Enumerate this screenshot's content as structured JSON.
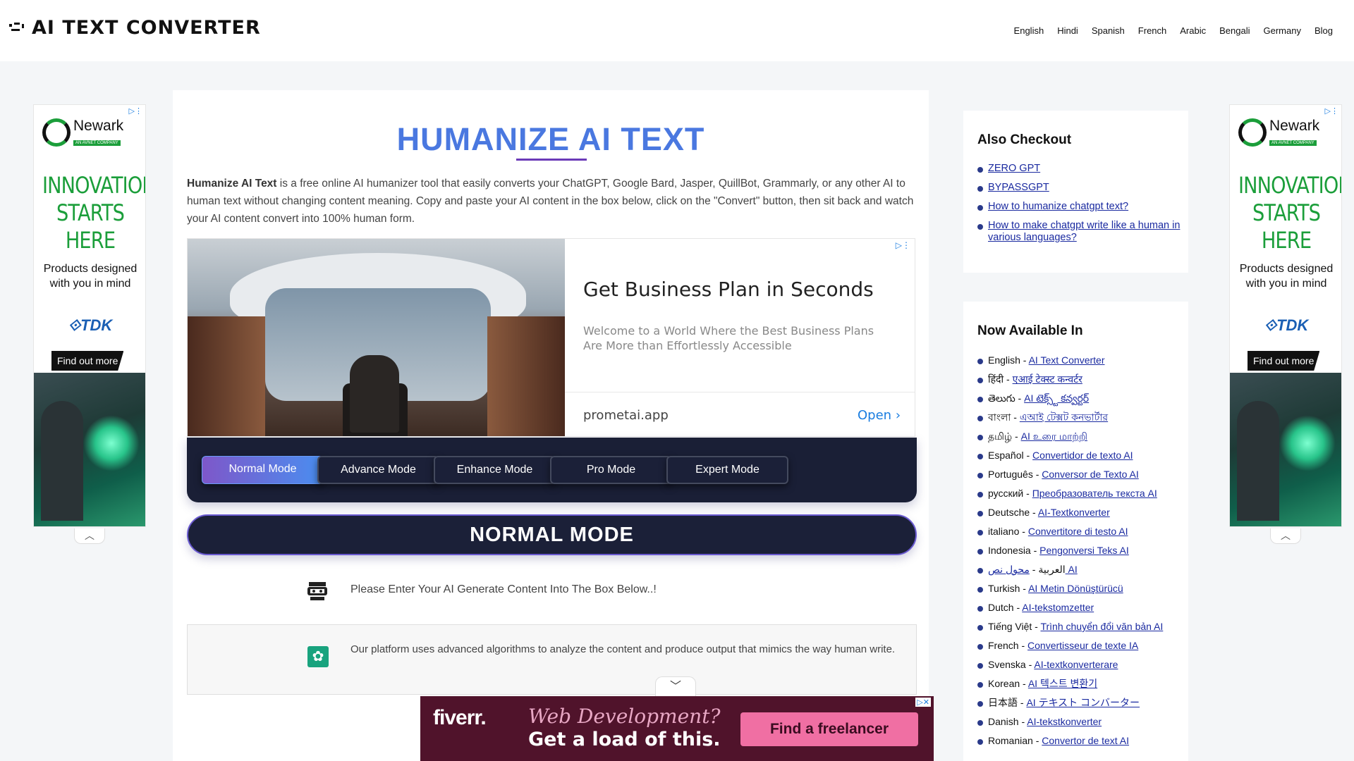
{
  "header": {
    "logo_text": "AI TEXT CONVERTER",
    "nav": [
      "English",
      "Hindi",
      "Spanish",
      "French",
      "Arabic",
      "Bengali",
      "Germany",
      "Blog"
    ]
  },
  "side_ad": {
    "brand": "Newark",
    "brand_sub": "AN AVNET COMPANY",
    "headline": "INNOVATION STARTS HERE",
    "tagline": "Products designed with you in mind",
    "partner": "TDK",
    "cta": "Find out more",
    "choices_icon": "ad-choices-icon",
    "collapse_icon": "chevron-up-icon"
  },
  "main": {
    "title": "HUMANIZE AI TEXT",
    "intro_bold": "Humanize AI Text",
    "intro_rest": " is a free online AI humanizer tool that easily converts your ChatGPT, Google Bard, Jasper, QuillBot, Grammarly, or any other AI to human text without changing content meaning. Copy and paste your AI content in the box below, click on the \"Convert\" button, then sit back and watch your AI content convert into 100% human form.",
    "biz_ad": {
      "title": "Get Business Plan in Seconds",
      "description": "Welcome to a World Where the Best Business Plans Are More than Effortlessly Accessible",
      "domain": "prometai.app",
      "open_label": "Open"
    },
    "modes": [
      "Normal Mode",
      "Advance Mode",
      "Enhance Mode",
      "Pro Mode",
      "Expert Mode"
    ],
    "active_mode": "Normal Mode",
    "mode_heading": "NORMAL MODE",
    "prompt": "Please Enter Your AI Generate Content Into The Box Below..!",
    "info": "Our platform uses advanced algorithms to analyze the content and produce output that mimics the way human write."
  },
  "sidebar": {
    "checkout_title": "Also Checkout",
    "checkout_links": [
      "ZERO GPT",
      "BYPASSGPT",
      "How to humanize chatgpt text?",
      "How to make chatgpt write like a human in various languages?"
    ],
    "langs_title": "Now Available In",
    "languages": [
      {
        "lang": "English",
        "link": "AI Text Converter"
      },
      {
        "lang": "हिंदी",
        "link": "एआई टेक्स्ट कन्वर्टर"
      },
      {
        "lang": "తెలుగు",
        "link": "AI టెక్స్ట్ కన్వర్టర్"
      },
      {
        "lang": "বাংলা",
        "link": "এআই টেক্সট কনভার্টার"
      },
      {
        "lang": "தமிழ்",
        "link": "AI உரை மாற்றி"
      },
      {
        "lang": "Español",
        "link": "Convertidor de texto AI"
      },
      {
        "lang": "Português",
        "link": "Conversor de Texto AI"
      },
      {
        "lang": "русский",
        "link": "Преобразователь текста AI"
      },
      {
        "lang": "Deutsche",
        "link": "AI-Textkonverter"
      },
      {
        "lang": "italiano",
        "link": "Convertitore di testo AI"
      },
      {
        "lang": "Indonesia",
        "link": "Pengonversi Teks AI"
      },
      {
        "lang": "العربية",
        "link": "محول نص AI"
      },
      {
        "lang": "Turkish",
        "link": "AI Metin Dönüştürücü"
      },
      {
        "lang": "Dutch",
        "link": "AI-tekstomzetter"
      },
      {
        "lang": "Tiếng Việt",
        "link": "Trình chuyển đổi văn bản AI"
      },
      {
        "lang": "French",
        "link": "Convertisseur de texte IA"
      },
      {
        "lang": "Svenska",
        "link": "AI-textkonverterare"
      },
      {
        "lang": "Korean",
        "link": "AI 텍스트 변환기"
      },
      {
        "lang": "日本語",
        "link": "AI テキスト コンバーター"
      },
      {
        "lang": "Danish",
        "link": "AI-tekstkonverter"
      },
      {
        "lang": "Romanian",
        "link": "Convertor de text AI"
      }
    ]
  },
  "anchor_ad": {
    "brand": "fiverr.",
    "tagline_1": "Web Development?",
    "tagline_2": "Get a load of this.",
    "cta": "Find a freelancer",
    "toggle_icon": "chevron-down-icon"
  },
  "colors": {
    "title_blue": "#4a78e0",
    "mode_bar": "#1a1f36",
    "active_mode_start": "#7e57c9",
    "active_mode_end": "#4a8ef0",
    "link": "#1a2aa0",
    "newark_green": "#1b9e3a",
    "fiverr_bg": "#50132b",
    "fiverr_button": "#f06fa3"
  }
}
